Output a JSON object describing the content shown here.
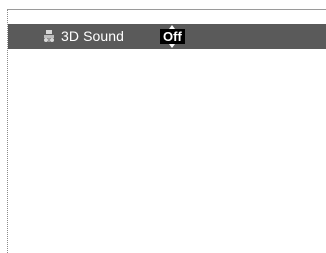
{
  "menu": {
    "item": {
      "icon": "speaker-3d-icon",
      "label": "3D Sound",
      "value": "Off"
    }
  },
  "colors": {
    "row_background": "#5a5a5a",
    "value_background": "#000000",
    "text": "#ffffff"
  }
}
